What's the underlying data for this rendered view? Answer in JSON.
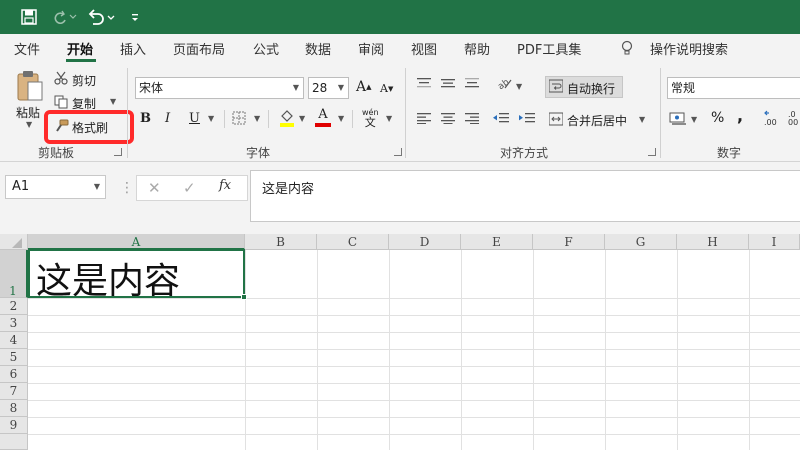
{
  "quick_access": {
    "save_icon": "save-icon",
    "redo_icon": "redo-icon",
    "undo_icon": "undo-icon",
    "customize_icon": "customize-qat-icon"
  },
  "tabs": [
    {
      "label": "文件"
    },
    {
      "label": "开始"
    },
    {
      "label": "插入"
    },
    {
      "label": "页面布局"
    },
    {
      "label": "公式"
    },
    {
      "label": "数据"
    },
    {
      "label": "审阅"
    },
    {
      "label": "视图"
    },
    {
      "label": "帮助"
    },
    {
      "label": "PDF工具集"
    }
  ],
  "tell_me": {
    "label": "操作说明搜索"
  },
  "clipboard": {
    "paste_label": "粘贴",
    "cut_label": "剪切",
    "copy_label": "复制",
    "format_painter_label": "格式刷",
    "group_label": "剪贴板"
  },
  "font": {
    "name": "宋体",
    "size": "28",
    "bold": "B",
    "italic": "I",
    "underline": "U",
    "font_color_letter": "A",
    "fill_color": "#ffff00",
    "font_color": "#e00000",
    "phonetic_top": "wén",
    "phonetic_bottom": "文",
    "group_label": "字体"
  },
  "alignment": {
    "wrap_text_label": "自动换行",
    "merge_center_label": "合并后居中",
    "group_label": "对齐方式"
  },
  "number": {
    "format": "常规",
    "percent": "%",
    "comma": ",",
    "group_label": "数字"
  },
  "formula_bar": {
    "name_box": "A1",
    "fx": "fx",
    "content": "这是内容"
  },
  "grid": {
    "columns": [
      "A",
      "B",
      "C",
      "D",
      "E",
      "F",
      "G",
      "H",
      "I"
    ],
    "rows": [
      "1",
      "2",
      "3",
      "4",
      "5",
      "6",
      "7",
      "8",
      "9"
    ],
    "cell_A1": "这是内容"
  },
  "colors": {
    "accent": "#217346",
    "highlight": "#ff2a2a"
  }
}
